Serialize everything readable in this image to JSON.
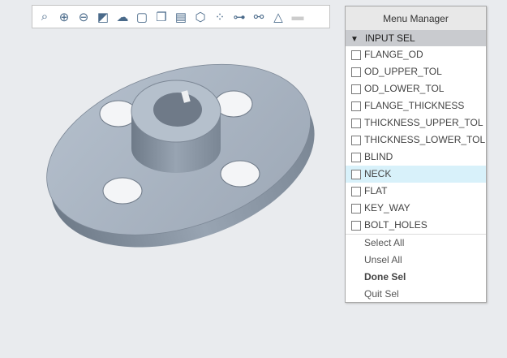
{
  "toolbar": {
    "icons": [
      "zoom-window-icon",
      "zoom-in-icon",
      "zoom-out-icon",
      "refit-icon",
      "appearance-icon",
      "display-style-icon",
      "saved-views-icon",
      "snapshot-icon",
      "perspective-icon",
      "datum-display-icon",
      "spin-center-icon",
      "annotation-icon",
      "model-tree-icon",
      "shade-icon"
    ]
  },
  "menu": {
    "title": "Menu Manager",
    "section": "INPUT SEL",
    "items": [
      {
        "label": "FLANGE_OD"
      },
      {
        "label": "OD_UPPER_TOL"
      },
      {
        "label": "OD_LOWER_TOL"
      },
      {
        "label": "FLANGE_THICKNESS"
      },
      {
        "label": "THICKNESS_UPPER_TOL"
      },
      {
        "label": "THICKNESS_LOWER_TOL"
      },
      {
        "label": "BLIND"
      },
      {
        "label": "NECK",
        "highlighted": true
      },
      {
        "label": "FLAT"
      },
      {
        "label": "KEY_WAY"
      },
      {
        "label": "BOLT_HOLES"
      }
    ],
    "actions": {
      "select_all": "Select All",
      "unsel_all": "Unsel All",
      "done_sel": "Done Sel",
      "quit_sel": "Quit Sel"
    }
  },
  "colors": {
    "highlight": "#d8f1fa",
    "model": "#a9b4c2"
  }
}
